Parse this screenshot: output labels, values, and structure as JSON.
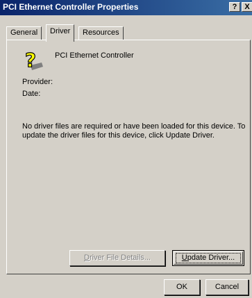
{
  "window": {
    "title": "PCI Ethernet Controller Properties",
    "help_label": "?",
    "close_label": "X"
  },
  "tabs": [
    {
      "label": "General"
    },
    {
      "label": "Driver"
    },
    {
      "label": "Resources"
    }
  ],
  "device": {
    "icon": "question-mark-device-icon",
    "name": "PCI Ethernet Controller"
  },
  "fields": {
    "provider_label": "Provider:",
    "date_label": "Date:"
  },
  "message": "No driver files are required or have been loaded for this device.  To update the driver files for this device, click Update Driver.",
  "buttons": {
    "details_mnemonic": "D",
    "details_rest": "river File Details...",
    "update_mnemonic": "U",
    "update_rest": "pdate Driver...",
    "ok": "OK",
    "cancel": "Cancel"
  }
}
